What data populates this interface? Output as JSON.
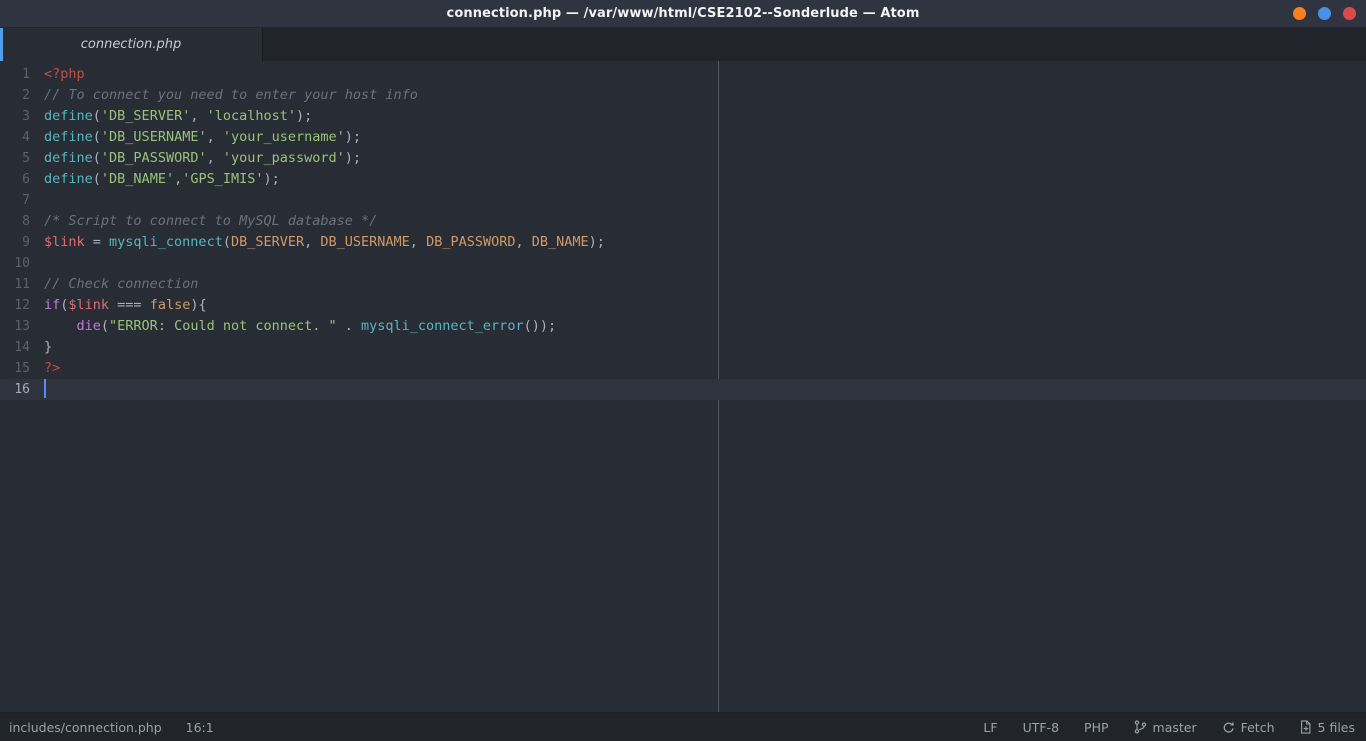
{
  "window": {
    "title": "connection.php — /var/www/html/CSE2102--Sonderlude — Atom",
    "controls": [
      {
        "name": "minimize",
        "icon": "minimize-circle-icon",
        "color": "#f98020"
      },
      {
        "name": "maximize",
        "icon": "maximize-circle-icon",
        "color": "#4a90e8"
      },
      {
        "name": "close",
        "icon": "close-circle-icon",
        "color": "#d94b4b"
      }
    ]
  },
  "tabs": [
    {
      "label": "connection.php",
      "active": true,
      "modified": true
    }
  ],
  "editor": {
    "language": "PHP",
    "wrap_guide_column": 80,
    "active_line": 16,
    "cursor": {
      "row": 16,
      "column": 1
    },
    "lines": [
      {
        "n": "1",
        "tokens": [
          {
            "t": "<?php",
            "c": "t-php"
          }
        ]
      },
      {
        "n": "2",
        "tokens": [
          {
            "t": "// To connect you need to enter your host info",
            "c": "t-comment"
          }
        ]
      },
      {
        "n": "3",
        "tokens": [
          {
            "t": "define",
            "c": "t-func"
          },
          {
            "t": "(",
            "c": "t-punct"
          },
          {
            "t": "'DB_SERVER'",
            "c": "t-string"
          },
          {
            "t": ", ",
            "c": "t-punct"
          },
          {
            "t": "'localhost'",
            "c": "t-string"
          },
          {
            "t": ");",
            "c": "t-punct"
          }
        ]
      },
      {
        "n": "4",
        "tokens": [
          {
            "t": "define",
            "c": "t-func"
          },
          {
            "t": "(",
            "c": "t-punct"
          },
          {
            "t": "'DB_USERNAME'",
            "c": "t-string"
          },
          {
            "t": ", ",
            "c": "t-punct"
          },
          {
            "t": "'your_username'",
            "c": "t-string"
          },
          {
            "t": ");",
            "c": "t-punct"
          }
        ]
      },
      {
        "n": "5",
        "tokens": [
          {
            "t": "define",
            "c": "t-func"
          },
          {
            "t": "(",
            "c": "t-punct"
          },
          {
            "t": "'DB_PASSWORD'",
            "c": "t-string"
          },
          {
            "t": ", ",
            "c": "t-punct"
          },
          {
            "t": "'your_password'",
            "c": "t-string"
          },
          {
            "t": ");",
            "c": "t-punct"
          }
        ]
      },
      {
        "n": "6",
        "tokens": [
          {
            "t": "define",
            "c": "t-func"
          },
          {
            "t": "(",
            "c": "t-punct"
          },
          {
            "t": "'DB_NAME'",
            "c": "t-string"
          },
          {
            "t": ",",
            "c": "t-punct"
          },
          {
            "t": "'GPS_IMIS'",
            "c": "t-string"
          },
          {
            "t": ");",
            "c": "t-punct"
          }
        ]
      },
      {
        "n": "7",
        "tokens": []
      },
      {
        "n": "8",
        "tokens": [
          {
            "t": "/* Script to connect to MySQL database */",
            "c": "t-comment"
          }
        ]
      },
      {
        "n": "9",
        "tokens": [
          {
            "t": "$link",
            "c": "t-var"
          },
          {
            "t": " = ",
            "c": "t-op"
          },
          {
            "t": "mysqli_connect",
            "c": "t-func"
          },
          {
            "t": "(",
            "c": "t-punct"
          },
          {
            "t": "DB_SERVER",
            "c": "t-const"
          },
          {
            "t": ", ",
            "c": "t-punct"
          },
          {
            "t": "DB_USERNAME",
            "c": "t-const"
          },
          {
            "t": ", ",
            "c": "t-punct"
          },
          {
            "t": "DB_PASSWORD",
            "c": "t-const"
          },
          {
            "t": ", ",
            "c": "t-punct"
          },
          {
            "t": "DB_NAME",
            "c": "t-const"
          },
          {
            "t": ");",
            "c": "t-punct"
          }
        ]
      },
      {
        "n": "10",
        "tokens": []
      },
      {
        "n": "11",
        "tokens": [
          {
            "t": "// Check connection",
            "c": "t-comment"
          }
        ]
      },
      {
        "n": "12",
        "tokens": [
          {
            "t": "if",
            "c": "t-keyword"
          },
          {
            "t": "(",
            "c": "t-punct"
          },
          {
            "t": "$link",
            "c": "t-var"
          },
          {
            "t": " === ",
            "c": "t-op"
          },
          {
            "t": "false",
            "c": "t-const"
          },
          {
            "t": "){",
            "c": "t-punct"
          }
        ]
      },
      {
        "n": "13",
        "tokens": [
          {
            "t": "    ",
            "c": "t-punct"
          },
          {
            "t": "die",
            "c": "t-keyword"
          },
          {
            "t": "(",
            "c": "t-punct"
          },
          {
            "t": "\"ERROR: Could not connect. \"",
            "c": "t-string"
          },
          {
            "t": " . ",
            "c": "t-op"
          },
          {
            "t": "mysqli_connect_error",
            "c": "t-func"
          },
          {
            "t": "());",
            "c": "t-punct"
          }
        ]
      },
      {
        "n": "14",
        "tokens": [
          {
            "t": "}",
            "c": "t-punct"
          }
        ]
      },
      {
        "n": "15",
        "tokens": [
          {
            "t": "?>",
            "c": "t-php"
          }
        ]
      },
      {
        "n": "16",
        "tokens": [],
        "cursor": true,
        "active": true
      }
    ]
  },
  "statusbar": {
    "left": [
      {
        "name": "file-path",
        "label": "includes/connection.php",
        "icon": null
      },
      {
        "name": "cursor-position",
        "label": "16:1",
        "icon": null
      }
    ],
    "right": [
      {
        "name": "line-ending",
        "label": "LF",
        "icon": null
      },
      {
        "name": "encoding",
        "label": "UTF-8",
        "icon": null
      },
      {
        "name": "grammar",
        "label": "PHP",
        "icon": null
      },
      {
        "name": "git-branch",
        "label": "master",
        "icon": "git-branch-icon"
      },
      {
        "name": "git-fetch",
        "label": "Fetch",
        "icon": "sync-icon"
      },
      {
        "name": "git-changed-files",
        "label": "5 files",
        "icon": "file-diff-icon"
      }
    ]
  },
  "colors": {
    "titlebar_bg": "#303440",
    "tabbar_bg": "#21252b",
    "editor_bg": "#282c34",
    "statusbar_bg": "#21252b",
    "accent": "#4d9eeb",
    "cursor": "#528bff",
    "active_line_bg": "#2f333d",
    "wrap_guide": "#4e5563",
    "syntax_php": "#be5046",
    "syntax_comment": "#6b727d",
    "syntax_function": "#56b6c2",
    "syntax_string": "#98c379",
    "syntax_constant": "#d19a66",
    "syntax_variable": "#e06c75",
    "syntax_keyword": "#c678dd",
    "text_default": "#abb2bf"
  }
}
